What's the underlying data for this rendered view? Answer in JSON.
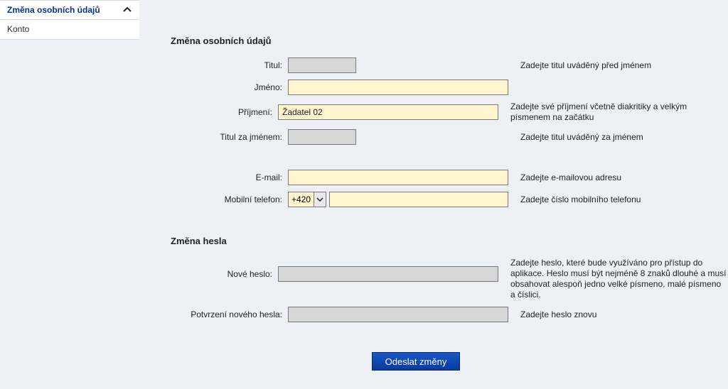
{
  "sidebar": {
    "items": [
      {
        "label": "Změna osobních údajů"
      },
      {
        "label": "Konto"
      }
    ]
  },
  "sections": {
    "personal": {
      "title": "Změna osobních údajů",
      "fields": {
        "titul": {
          "label": "Titul:",
          "value": "",
          "help": "Zadejte titul uváděný před jménem"
        },
        "jmeno": {
          "label": "Jméno:",
          "value": "",
          "help": ""
        },
        "prijmeni": {
          "label": "Příjmení:",
          "value": "Žadatel 02",
          "help": "Zadejte své příjmení včetně diakritiky a velkým písmenem na začátku"
        },
        "titul_za": {
          "label": "Titul za jménem:",
          "value": "",
          "help": "Zadejte titul uváděný za jménem"
        },
        "email": {
          "label": "E-mail:",
          "value": "",
          "help": "Zadejte e-mailovou adresu"
        },
        "telefon": {
          "label": "Mobilní telefon:",
          "prefix": "+420",
          "value": "",
          "help": "Zadejte číslo mobilního telefonu"
        }
      }
    },
    "password": {
      "title": "Změna hesla",
      "fields": {
        "nove": {
          "label": "Nové heslo:",
          "value": "",
          "help": "Zadejte heslo, které bude využíváno pro přístup do aplikace. Heslo musí být nejméně 8 znaků dlouhé a musí obsahovat alespoň jedno velké písmeno, malé písmeno a číslici."
        },
        "potvrz": {
          "label": "Potvrzení nového hesla:",
          "value": "",
          "help": "Zadejte heslo znovu"
        }
      }
    }
  },
  "submit": {
    "label": "Odeslat změny"
  }
}
